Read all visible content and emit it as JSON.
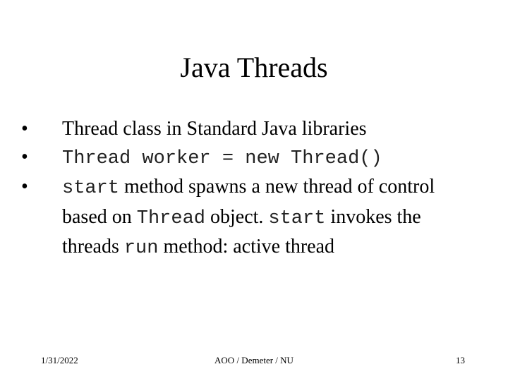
{
  "slide": {
    "title": "Java Threads",
    "bullets": [
      {
        "segments": [
          {
            "text": "Thread class in Standard Java libraries",
            "code": false
          }
        ]
      },
      {
        "segments": [
          {
            "text": "Thread worker = new Thread()",
            "code": true
          }
        ]
      },
      {
        "segments": [
          {
            "text": "start",
            "code": true
          },
          {
            "text": " method spawns a new thread of control based on ",
            "code": false
          },
          {
            "text": "Thread",
            "code": true
          },
          {
            "text": " object. ",
            "code": false
          },
          {
            "text": "start",
            "code": true
          },
          {
            "text": " invokes the threads ",
            "code": false
          },
          {
            "text": "run",
            "code": true
          },
          {
            "text": " method: active thread",
            "code": false
          }
        ]
      }
    ]
  },
  "footer": {
    "date": "1/31/2022",
    "center": "AOO / Demeter / NU",
    "page_number": "13"
  }
}
